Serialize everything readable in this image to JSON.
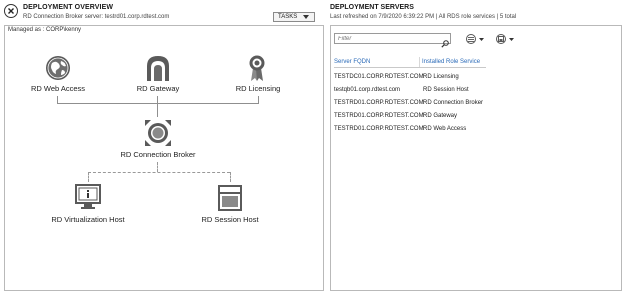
{
  "overview": {
    "title": "DEPLOYMENT OVERVIEW",
    "subtitle": "RD Connection Broker server: testrd01.corp.rdtest.com",
    "tasks_label": "TASKS",
    "managed_as": "Managed as : CORP\\kenny",
    "roles": {
      "web_access": "RD Web Access",
      "gateway": "RD Gateway",
      "licensing": "RD Licensing",
      "broker": "RD Connection Broker",
      "virtualization": "RD Virtualization Host",
      "session": "RD Session Host"
    }
  },
  "servers": {
    "title": "DEPLOYMENT SERVERS",
    "subtitle": "Last refreshed on 7/9/2020 6:39:22 PM | All RDS role services | 5 total",
    "filter_placeholder": "Filter",
    "columns": [
      "Server FQDN",
      "Installed Role Service"
    ],
    "rows": [
      [
        "TESTDC01.CORP.RDTEST.COM",
        "RD Licensing"
      ],
      [
        "testqb01.corp.rdtest.com",
        "RD Session Host"
      ],
      [
        "TESTRD01.CORP.RDTEST.COM",
        "RD Connection Broker"
      ],
      [
        "TESTRD01.CORP.RDTEST.COM",
        "RD Gateway"
      ],
      [
        "TESTRD01.CORP.RDTEST.COM",
        "RD Web Access"
      ]
    ]
  }
}
